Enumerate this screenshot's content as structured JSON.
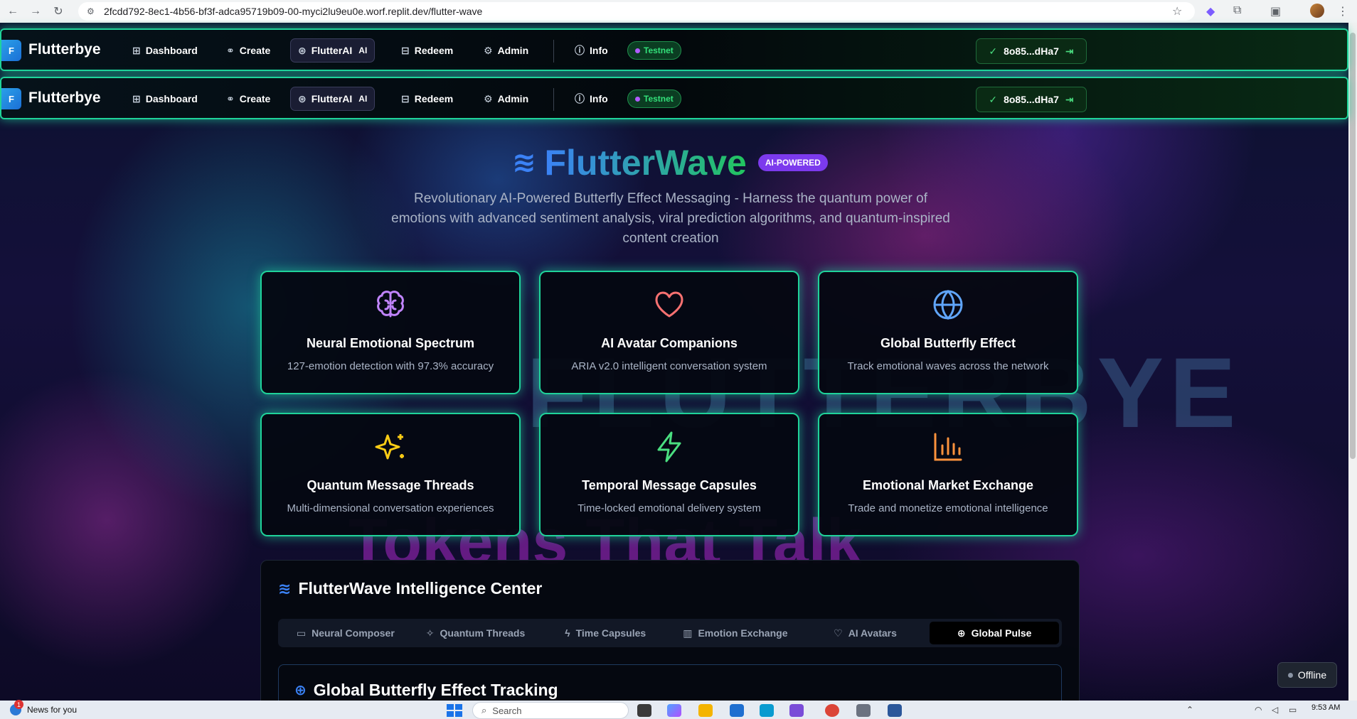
{
  "browser": {
    "url": "2fcdd792-8ec1-4b56-bf3f-adca95719b09-00-myci2lu9eu0e.worf.replit.dev/flutter-wave"
  },
  "nav": {
    "logo_letter": "F",
    "brand": "Flutterbye",
    "items": [
      {
        "label": "Dashboard",
        "icon": "grid-icon"
      },
      {
        "label": "Create",
        "icon": "link-icon"
      },
      {
        "label": "FlutterAI",
        "tag": "AI",
        "icon": "brain-icon"
      },
      {
        "label": "Redeem",
        "icon": "gift-icon"
      },
      {
        "label": "Admin",
        "icon": "gear-icon"
      },
      {
        "label": "Info",
        "icon": "help-circle-icon"
      }
    ],
    "network_badge": "Testnet",
    "wallet": "8o85...dHa7"
  },
  "background": {
    "text_top": "FLUTTERBYE",
    "text_bottom": "Tokens That Talk"
  },
  "hero": {
    "title": "FlutterWave",
    "badge": "AI-POWERED",
    "subtitle": "Revolutionary AI-Powered Butterfly Effect Messaging - Harness the quantum power of emotions with advanced sentiment analysis, viral prediction algorithms, and quantum-inspired content creation"
  },
  "features": [
    {
      "title": "Neural Emotional Spectrum",
      "desc": "127-emotion detection with 97.3% accuracy",
      "icon": "brain-icon",
      "color": "#c084fc"
    },
    {
      "title": "AI Avatar Companions",
      "desc": "ARIA v2.0 intelligent conversation system",
      "icon": "heart-icon",
      "color": "#f87171"
    },
    {
      "title": "Global Butterfly Effect",
      "desc": "Track emotional waves across the network",
      "icon": "globe-icon",
      "color": "#60a5fa"
    },
    {
      "title": "Quantum Message Threads",
      "desc": "Multi-dimensional conversation experiences",
      "icon": "sparkles-icon",
      "color": "#facc15"
    },
    {
      "title": "Temporal Message Capsules",
      "desc": "Time-locked emotional delivery system",
      "icon": "lightning-icon",
      "color": "#4ade80"
    },
    {
      "title": "Emotional Market Exchange",
      "desc": "Trade and monetize emotional intelligence",
      "icon": "bar-chart-icon",
      "color": "#fb923c"
    }
  ],
  "intel": {
    "title": "FlutterWave Intelligence Center",
    "tabs": [
      {
        "label": "Neural Composer",
        "icon": "message-icon"
      },
      {
        "label": "Quantum Threads",
        "icon": "sparkles-icon"
      },
      {
        "label": "Time Capsules",
        "icon": "lightning-icon"
      },
      {
        "label": "Emotion Exchange",
        "icon": "bar-chart-icon"
      },
      {
        "label": "AI Avatars",
        "icon": "heart-icon"
      },
      {
        "label": "Global Pulse",
        "icon": "globe-icon"
      }
    ],
    "active_tab": "Global Pulse",
    "section_title": "Global Butterfly Effect Tracking"
  },
  "status": {
    "offline": "Offline"
  },
  "taskbar": {
    "news": "News for you",
    "news_count": "1",
    "search_placeholder": "Search",
    "time": "9:53 AM"
  }
}
